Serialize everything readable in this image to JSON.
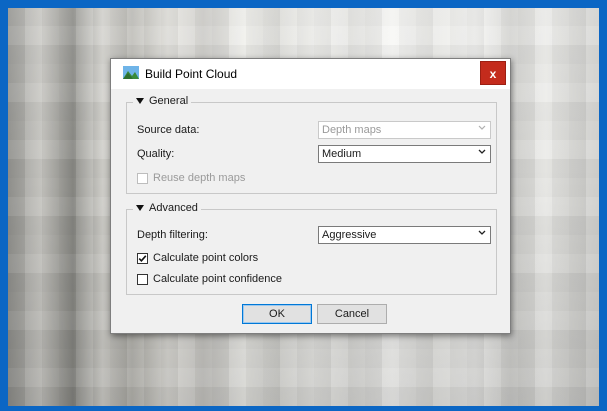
{
  "dialog": {
    "title": "Build Point Cloud",
    "close_label": "x",
    "icon": "point-cloud-app-icon"
  },
  "general": {
    "heading": "General",
    "source_label": "Source data:",
    "source_value": "Depth maps",
    "source_enabled": false,
    "quality_label": "Quality:",
    "quality_value": "Medium",
    "reuse_label": "Reuse depth maps",
    "reuse_checked": false,
    "reuse_enabled": false
  },
  "advanced": {
    "heading": "Advanced",
    "filtering_label": "Depth filtering:",
    "filtering_value": "Aggressive",
    "colors_label": "Calculate point colors",
    "colors_checked": true,
    "confidence_label": "Calculate point confidence",
    "confidence_checked": false
  },
  "buttons": {
    "ok": "OK",
    "cancel": "Cancel"
  },
  "colors": {
    "desktop_frame": "#0b66c4",
    "close_button": "#c42b1c",
    "default_button_border": "#0078d7"
  }
}
